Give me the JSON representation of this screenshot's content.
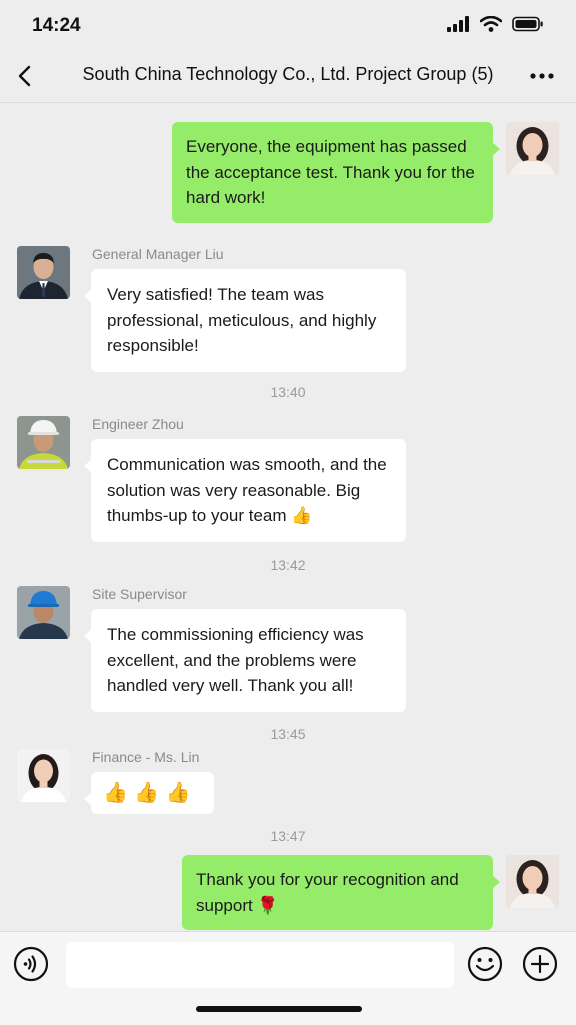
{
  "status_bar": {
    "time": "14:24"
  },
  "nav": {
    "title": "South China Technology Co., Ltd. Project Group (5)"
  },
  "messages": [
    {
      "direction": "out",
      "text": "Everyone, the equipment has passed the acceptance test. Thank you for the hard work!"
    },
    {
      "direction": "in",
      "sender": "General Manager Liu",
      "text": "Very satisfied! The team was professional, meticulous, and highly responsible!"
    },
    {
      "type": "time",
      "text": "13:40"
    },
    {
      "direction": "in",
      "sender": "Engineer Zhou",
      "text": "Communication was smooth, and the solution was very reasonable. Big thumbs-up to your team 👍"
    },
    {
      "type": "time",
      "text": "13:42"
    },
    {
      "direction": "in",
      "sender": "Site Supervisor",
      "text": "The commissioning efficiency was excellent, and the problems were handled very well. Thank you all!"
    },
    {
      "type": "time",
      "text": "13:45"
    },
    {
      "direction": "in",
      "sender": "Finance - Ms. Lin",
      "text": "👍 👍 👍"
    },
    {
      "type": "time",
      "text": "13:47"
    },
    {
      "direction": "out",
      "text": "Thank you for your recognition and support 🌹"
    }
  ],
  "input": {
    "placeholder": ""
  },
  "icons": {
    "back": "chevron-left-icon",
    "more": "more-dots-icon",
    "voice": "voice-icon",
    "emoji": "emoji-icon",
    "plus": "plus-icon"
  },
  "colors": {
    "outgoing_bubble": "#95ec69",
    "incoming_bubble": "#ffffff",
    "background": "#ededed"
  }
}
